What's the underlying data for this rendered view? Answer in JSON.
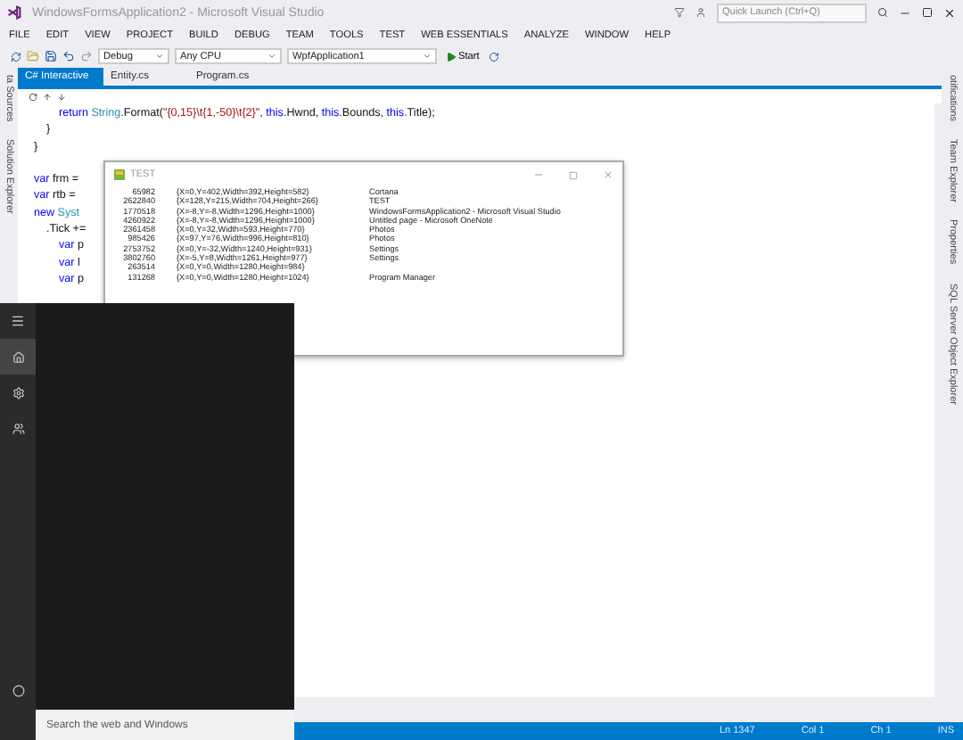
{
  "window": {
    "title": "WindowsFormsApplication2 - Microsoft Visual Studio"
  },
  "quick_launch": {
    "placeholder": "Quick Launch (Ctrl+Q)"
  },
  "menu": [
    "FILE",
    "EDIT",
    "VIEW",
    "PROJECT",
    "BUILD",
    "DEBUG",
    "TEAM",
    "TOOLS",
    "TEST",
    "WEB ESSENTIALS",
    "ANALYZE",
    "WINDOW",
    "HELP"
  ],
  "toolbar": {
    "configuration": "Debug",
    "platform": "Any CPU",
    "project": "WpfApplication1",
    "start": "Start"
  },
  "tabs": [
    {
      "label": "C# Interactive",
      "selected": true
    },
    {
      "label": "Entity.cs",
      "selected": false
    },
    {
      "label": "Program.cs",
      "selected": false
    }
  ],
  "left_panels": [
    "ta Sources",
    "Solution Explorer"
  ],
  "right_panels": [
    "otifications",
    "Team Explorer",
    "Properties",
    "SQL Server Object Explorer"
  ],
  "code_lines": [
    {
      "kind": "code",
      "tokens": [
        {
          "text": "        return ",
          "kind": "keyword"
        },
        {
          "text": "String",
          "kind": "type"
        },
        {
          "text": ".Format(",
          "kind": "plain"
        },
        {
          "text": "\"{0,15}\\t{1,-50}\\t{2}\"",
          "kind": "string"
        },
        {
          "text": ", ",
          "kind": "plain"
        },
        {
          "text": "this",
          "kind": "keyword"
        },
        {
          "text": ".Hwnd, ",
          "kind": "plain"
        },
        {
          "text": "this",
          "kind": "keyword"
        },
        {
          "text": ".Bounds, ",
          "kind": "plain"
        },
        {
          "text": "this",
          "kind": "keyword"
        },
        {
          "text": ".Title);",
          "kind": "plain"
        }
      ]
    },
    {
      "kind": "code",
      "tokens": [
        {
          "text": "    }",
          "kind": "plain"
        }
      ]
    },
    {
      "kind": "code",
      "tokens": [
        {
          "text": "}",
          "kind": "plain"
        }
      ]
    },
    {
      "kind": "blank"
    },
    {
      "kind": "code",
      "tokens": [
        {
          "text": "var",
          "kind": "keyword"
        },
        {
          "text": " frm =",
          "kind": "plain"
        }
      ]
    },
    {
      "kind": "code",
      "tokens": [
        {
          "text": "var",
          "kind": "keyword"
        },
        {
          "text": " rtb =",
          "kind": "plain"
        }
      ]
    },
    {
      "kind": "code",
      "tokens": [
        {
          "text": "new",
          "kind": "keyword"
        },
        {
          "text": " Syst",
          "kind": "type"
        }
      ]
    },
    {
      "kind": "code",
      "tokens": [
        {
          "text": "    .Tick +=",
          "kind": "plain"
        }
      ]
    },
    {
      "kind": "code",
      "tokens": [
        {
          "text": "        var",
          "kind": "keyword"
        },
        {
          "text": " p",
          "kind": "plain"
        }
      ]
    },
    {
      "kind": "code",
      "tokens": [
        {
          "text": "        var",
          "kind": "keyword"
        },
        {
          "text": " l",
          "kind": "plain"
        }
      ]
    },
    {
      "kind": "code",
      "tokens": [
        {
          "text": "        var",
          "kind": "keyword"
        },
        {
          "text": " p",
          "kind": "plain"
        }
      ]
    }
  ],
  "test_window": {
    "title": "TEST",
    "rows": [
      {
        "handle": "65982",
        "bounds": "{X=0,Y=402,Width=392,Height=582}",
        "title": "Cortana"
      },
      {
        "handle": "2622840",
        "bounds": "{X=128,Y=215,Width=704,Height=266}",
        "title": "TEST"
      },
      {
        "handle": "1770518",
        "bounds": "{X=-8,Y=-8,Width=1296,Height=1000}",
        "title": "WindowsFormsApplication2 - Microsoft Visual Studio"
      },
      {
        "handle": "4260922",
        "bounds": "{X=-8,Y=-8,Width=1296,Height=1000}",
        "title": "Untitled page - Microsoft OneNote"
      },
      {
        "handle": "2361458",
        "bounds": "{X=0,Y=32,Width=593,Height=770}",
        "title": "Photos"
      },
      {
        "handle": "985426",
        "bounds": "{X=97,Y=76,Width=996,Height=810}",
        "title": "Photos"
      },
      {
        "handle": "2753752",
        "bounds": "{X=0,Y=-32,Width=1240,Height=931}",
        "title": "Settings"
      },
      {
        "handle": "3802760",
        "bounds": "{X=-5,Y=8,Width=1261,Height=977}",
        "title": "Settings"
      },
      {
        "handle": "263514",
        "bounds": "{X=0,Y=0,Width=1280,Height=984}"
      },
      {
        "handle": "131268",
        "bounds": "{X=0,Y=0,Width=1280,Height=1024}",
        "title": "Program Manager"
      }
    ]
  },
  "start_menu": {
    "search": {
      "placeholder": "Search the web and Windows"
    }
  },
  "status_bar": {
    "line": "Ln 1347",
    "col": "Col 1",
    "ch": "Ch 1",
    "mode": "INS"
  }
}
